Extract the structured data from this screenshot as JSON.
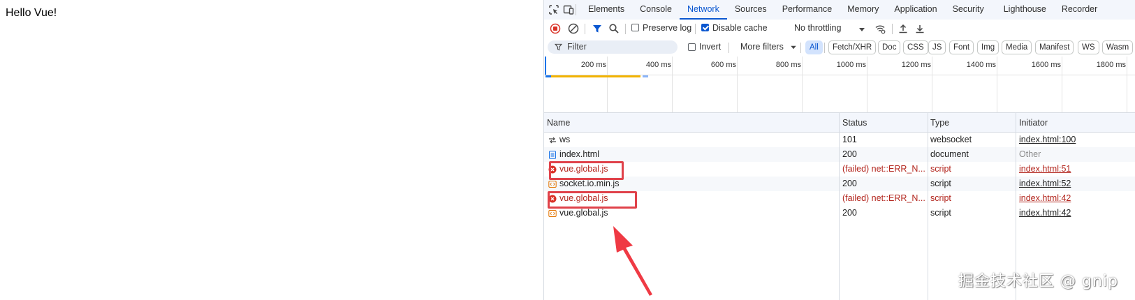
{
  "page": {
    "text": "Hello Vue!"
  },
  "devtools": {
    "tabs": [
      {
        "label": "Elements"
      },
      {
        "label": "Console"
      },
      {
        "label": "Network",
        "active": true
      },
      {
        "label": "Sources"
      },
      {
        "label": "Performance"
      },
      {
        "label": "Memory"
      },
      {
        "label": "Application"
      },
      {
        "label": "Security"
      },
      {
        "label": "Lighthouse"
      },
      {
        "label": "Recorder"
      }
    ],
    "toolbar": {
      "preserve_log_label": "Preserve log",
      "preserve_log_checked": false,
      "disable_cache_label": "Disable cache",
      "disable_cache_checked": true,
      "throttling_value": "No throttling"
    },
    "filterbar": {
      "placeholder": "Filter",
      "invert_label": "Invert",
      "invert_checked": false,
      "more_filters_label": "More filters",
      "chips": [
        "All",
        "Fetch/XHR",
        "Doc",
        "CSS",
        "JS",
        "Font",
        "Img",
        "Media",
        "Manifest",
        "WS",
        "Wasm"
      ],
      "active_chip": "All"
    },
    "overview": {
      "ticks": [
        "200 ms",
        "400 ms",
        "600 ms",
        "800 ms",
        "1000 ms",
        "1200 ms",
        "1400 ms",
        "1600 ms",
        "1800 ms"
      ]
    },
    "table": {
      "columns": {
        "name": "Name",
        "status": "Status",
        "type": "Type",
        "initiator": "Initiator"
      },
      "rows": [
        {
          "name": "ws",
          "status": "101",
          "type": "websocket",
          "initiator": "index.html:100",
          "icon": "websocket-icon",
          "failed": false
        },
        {
          "name": "index.html",
          "status": "200",
          "type": "document",
          "initiator": "Other",
          "icon": "document-icon",
          "failed": false
        },
        {
          "name": "vue.global.js",
          "status": "(failed) net::ERR_N...",
          "type": "script",
          "initiator": "index.html:51",
          "icon": "error-icon",
          "failed": true
        },
        {
          "name": "socket.io.min.js",
          "status": "200",
          "type": "script",
          "initiator": "index.html:52",
          "icon": "script-icon",
          "failed": false
        },
        {
          "name": "vue.global.js",
          "status": "(failed) net::ERR_N...",
          "type": "script",
          "initiator": "index.html:42",
          "icon": "error-icon",
          "failed": true
        },
        {
          "name": "vue.global.js",
          "status": "200",
          "type": "script",
          "initiator": "index.html:42",
          "icon": "script-icon",
          "failed": false
        }
      ]
    }
  },
  "watermark": {
    "text": "掘金技术社区 @ gnip"
  },
  "colors": {
    "accent": "#0b57d0",
    "error": "#b3261e",
    "highlight": "#e0424a"
  }
}
